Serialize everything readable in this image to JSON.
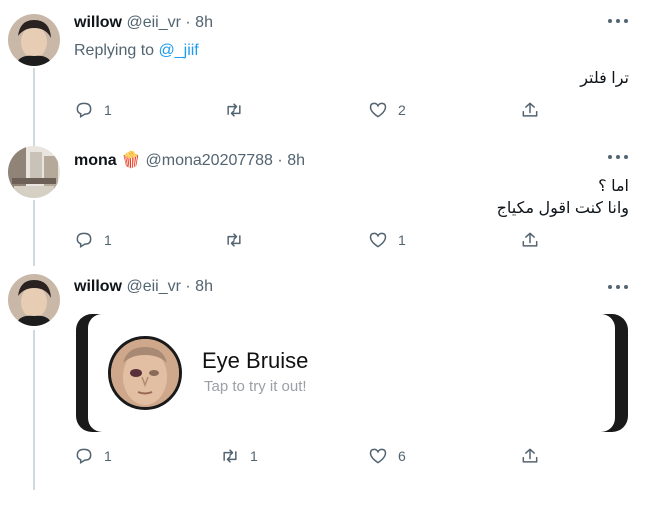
{
  "tweets": [
    {
      "name": "willow",
      "handle": "@eii_vr",
      "time": "8h",
      "replying_prefix": "Replying to ",
      "replying_mention": "@_jiif",
      "text": "ترا فلتر",
      "reply_count": "1",
      "retweet_count": "",
      "like_count": "2"
    },
    {
      "name": "mona",
      "name_emoji": "🍿",
      "handle": "@mona20207788",
      "time": "8h",
      "text_line1": "اما ؟",
      "text_line2": "وانا كنت اقول مكياج",
      "reply_count": "1",
      "retweet_count": "",
      "like_count": "1"
    },
    {
      "name": "willow",
      "handle": "@eii_vr",
      "time": "8h",
      "card_title": "Eye Bruise",
      "card_subtitle": "Tap to try it out!",
      "reply_count": "1",
      "retweet_count": "1",
      "like_count": "6"
    }
  ],
  "separator": "·",
  "icons": {
    "reply": "reply-icon",
    "retweet": "retweet-icon",
    "like": "heart-icon",
    "share": "share-icon",
    "more": "more-icon"
  },
  "colors": {
    "mention": "#1d9bf0",
    "meta": "#536471",
    "thread_line": "#cfd9de"
  }
}
